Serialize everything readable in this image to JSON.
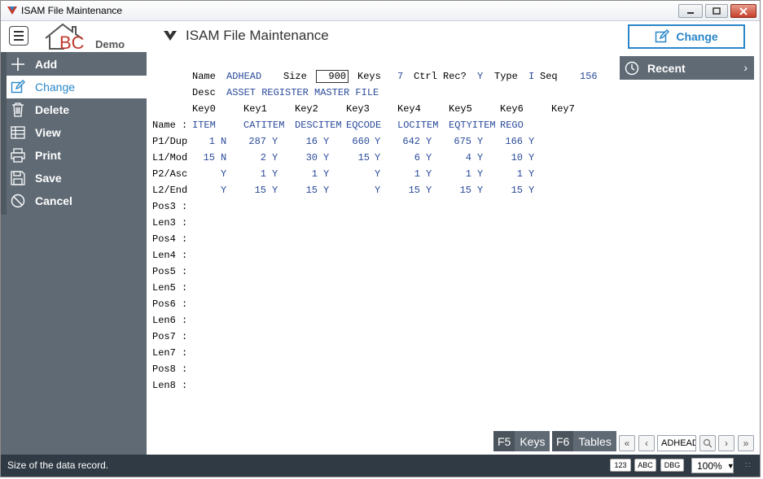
{
  "window": {
    "title": "ISAM File Maintenance"
  },
  "header": {
    "logo_demo": "Demo",
    "logo_letters": "BC",
    "title": "ISAM File Maintenance",
    "mode_button": "Change"
  },
  "sidebar": {
    "items": [
      {
        "label": "Add",
        "icon": "plus-icon",
        "active": false
      },
      {
        "label": "Change",
        "icon": "edit-icon",
        "active": true
      },
      {
        "label": "Delete",
        "icon": "trash-icon",
        "active": false
      },
      {
        "label": "View",
        "icon": "table-icon",
        "active": false
      },
      {
        "label": "Print",
        "icon": "printer-icon",
        "active": false
      },
      {
        "label": "Save",
        "icon": "save-icon",
        "active": false
      },
      {
        "label": "Cancel",
        "icon": "cancel-icon",
        "active": false
      }
    ]
  },
  "recent": {
    "label": "Recent"
  },
  "form": {
    "name_label": "Name",
    "name_value": "ADHEAD",
    "size_label": "Size",
    "size_value": "900",
    "keys_label": "Keys",
    "keys_value": "7",
    "ctrl_label": "Ctrl Rec?",
    "ctrl_value": "Y",
    "type_label": "Type",
    "type_value": "I",
    "seq_label": "Seq",
    "seq_value": "156",
    "desc_label": "Desc",
    "desc_value": "ASSET REGISTER MASTER FILE",
    "key_headers": [
      "Key0",
      "Key1",
      "Key2",
      "Key3",
      "Key4",
      "Key5",
      "Key6",
      "Key7"
    ],
    "row_labels": [
      "Name :",
      "P1/Dup",
      "L1/Mod",
      "P2/Asc",
      "L2/End",
      "Pos3 :",
      "Len3 :",
      "Pos4 :",
      "Len4 :",
      "Pos5 :",
      "Len5 :",
      "Pos6 :",
      "Len6 :",
      "Pos7 :",
      "Len7 :",
      "Pos8 :",
      "Len8 :"
    ],
    "key_names": [
      "ITEM",
      "CATITEM",
      "DESCITEM",
      "EQCODE",
      "LOCITEM",
      "EQTYITEM",
      "REGO"
    ],
    "p1_nums": [
      "1",
      "287",
      "16",
      "660",
      "642",
      "675",
      "166"
    ],
    "p1_flags": [
      "N",
      "Y",
      "Y",
      "Y",
      "Y",
      "Y",
      "Y"
    ],
    "l1_nums": [
      "15",
      "2",
      "30",
      "15",
      "6",
      "4",
      "10"
    ],
    "l1_flags": [
      "N",
      "Y",
      "Y",
      "Y",
      "Y",
      "Y",
      "Y"
    ],
    "p2_nums": [
      "",
      "1",
      "1",
      "",
      "1",
      "1",
      "1"
    ],
    "p2_flags": [
      "Y",
      "Y",
      "Y",
      "Y",
      "Y",
      "Y",
      "Y"
    ],
    "l2_nums": [
      "",
      "15",
      "15",
      "",
      "15",
      "15",
      "15"
    ],
    "l2_flags": [
      "Y",
      "Y",
      "Y",
      "Y",
      "Y",
      "Y",
      "Y"
    ]
  },
  "bottom": {
    "f5_key": "F5",
    "f5_label": "Keys",
    "f6_key": "F6",
    "f6_label": "Tables",
    "nav_value": "ADHEAD"
  },
  "status": {
    "message": "Size of the data record.",
    "chip_123": "123",
    "chip_abc": "ABC",
    "chip_dbg": "DBG",
    "zoom": "100%"
  },
  "colors": {
    "accent": "#2a86c8",
    "sidebar": "#5f6a74",
    "statusbar": "#2f3a44",
    "value_text": "#2a4a9a"
  }
}
